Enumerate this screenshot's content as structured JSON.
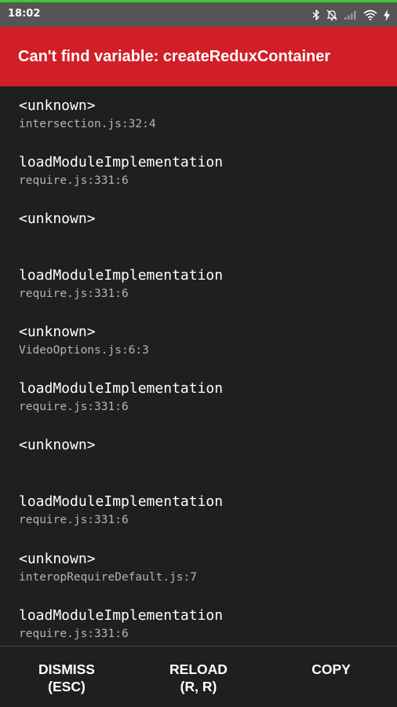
{
  "status_bar": {
    "time": "18:02",
    "icons": [
      "bluetooth-icon",
      "mute-icon",
      "signal-icon",
      "wifi-icon",
      "charging-icon"
    ]
  },
  "error": {
    "message": "Can't find variable: createReduxContainer"
  },
  "stack": [
    {
      "method": "<unknown>",
      "file": "intersection.js:32:4"
    },
    {
      "method": "loadModuleImplementation",
      "file": "require.js:331:6"
    },
    {
      "method": "<unknown>",
      "file": ""
    },
    {
      "method": "loadModuleImplementation",
      "file": "require.js:331:6"
    },
    {
      "method": "<unknown>",
      "file": "VideoOptions.js:6:3"
    },
    {
      "method": "loadModuleImplementation",
      "file": "require.js:331:6"
    },
    {
      "method": "<unknown>",
      "file": ""
    },
    {
      "method": "loadModuleImplementation",
      "file": "require.js:331:6"
    },
    {
      "method": "<unknown>",
      "file": "interopRequireDefault.js:7"
    },
    {
      "method": "loadModuleImplementation",
      "file": "require.js:331:6"
    }
  ],
  "actions": {
    "dismiss": {
      "label": "DISMISS",
      "hint": "(ESC)"
    },
    "reload": {
      "label": "RELOAD",
      "hint": "(R, R)"
    },
    "copy": {
      "label": "COPY"
    }
  },
  "colors": {
    "header_red": "#d11f28",
    "background": "#1f1f1f",
    "status_bar": "#555555",
    "indicator_green": "#37c837"
  }
}
